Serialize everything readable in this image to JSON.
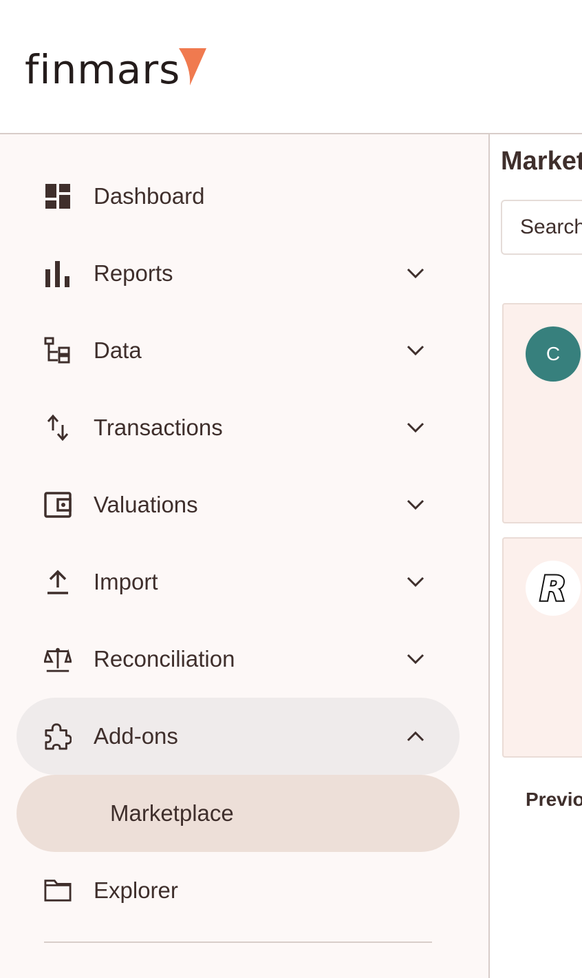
{
  "brand": {
    "name": "finmars",
    "accent": "#f07a4f"
  },
  "sidebar": {
    "items": [
      {
        "label": "Dashboard",
        "icon": "dashboard-icon",
        "chevron": "none"
      },
      {
        "label": "Reports",
        "icon": "bar-chart-icon",
        "chevron": "down"
      },
      {
        "label": "Data",
        "icon": "data-tree-icon",
        "chevron": "down"
      },
      {
        "label": "Transactions",
        "icon": "swap-vertical-icon",
        "chevron": "down"
      },
      {
        "label": "Valuations",
        "icon": "wallet-icon",
        "chevron": "down"
      },
      {
        "label": "Import",
        "icon": "upload-icon",
        "chevron": "down"
      },
      {
        "label": "Reconciliation",
        "icon": "scale-icon",
        "chevron": "down"
      },
      {
        "label": "Add-ons",
        "icon": "puzzle-icon",
        "chevron": "up",
        "state": "expanded"
      },
      {
        "label": "Marketplace",
        "icon": "",
        "chevron": "none",
        "state": "selected"
      },
      {
        "label": "Explorer",
        "icon": "folder-icon",
        "chevron": "none"
      }
    ]
  },
  "main": {
    "title": "Marketplace",
    "search": {
      "placeholder": "Search",
      "value": ""
    },
    "cards": [
      {
        "avatar_letter": "C",
        "avatar_color": "#37807d"
      },
      {
        "avatar_logo": "R",
        "avatar_color": "#ffffff"
      }
    ],
    "pagination": {
      "prev_label": "Previous"
    }
  },
  "colors": {
    "sidebar_bg": "#fdf8f7",
    "selected_bg": "#eddfd8",
    "expanded_bg": "#efebeb",
    "text": "#3f2f2c",
    "card_bg": "#fcf0ec"
  }
}
